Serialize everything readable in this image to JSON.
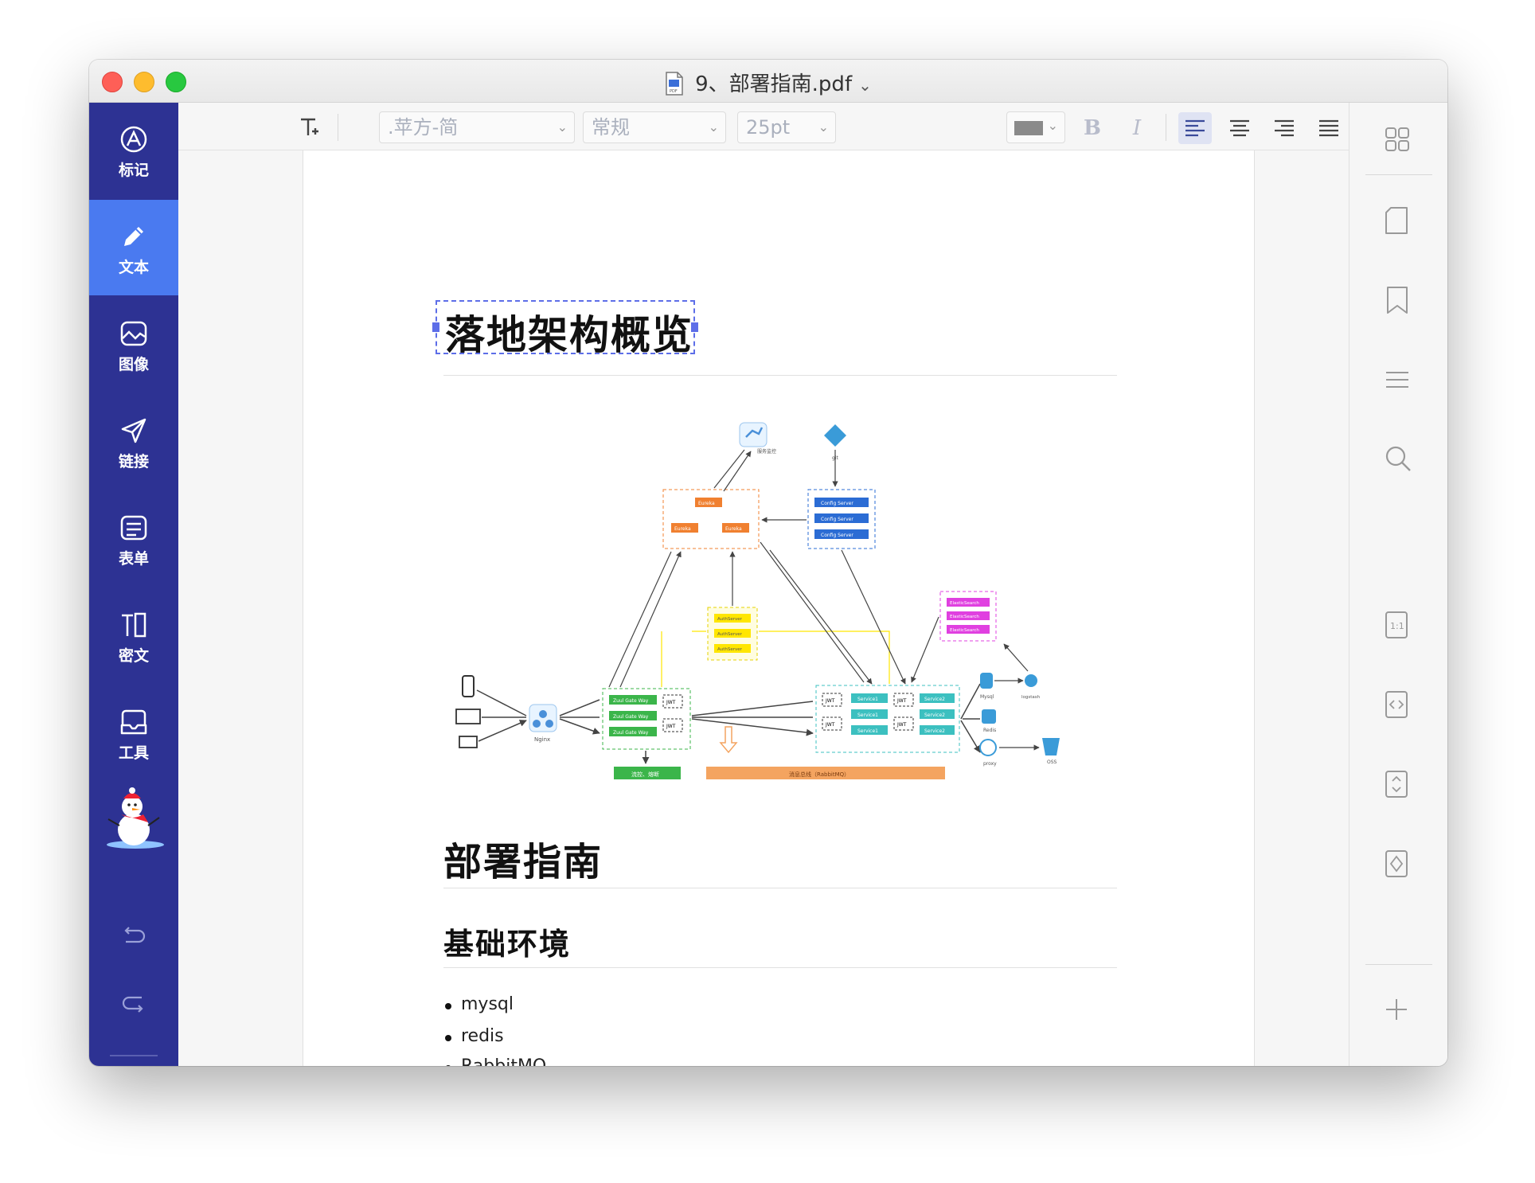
{
  "window": {
    "title": "9、部署指南.pdf"
  },
  "sidebar": {
    "items": [
      {
        "label": "标记",
        "icon": "markup-icon"
      },
      {
        "label": "文本",
        "icon": "pencil-icon",
        "active": true
      },
      {
        "label": "图像",
        "icon": "image-icon"
      },
      {
        "label": "链接",
        "icon": "link-icon"
      },
      {
        "label": "表单",
        "icon": "form-icon"
      },
      {
        "label": "密文",
        "icon": "redact-icon"
      },
      {
        "label": "工具",
        "icon": "tools-icon"
      }
    ],
    "active_color": "#4a7af0",
    "bg_color": "#2d3293"
  },
  "toolbar": {
    "font_family": ".苹方-简",
    "font_weight": "常规",
    "font_size": "25pt",
    "text_color": "#8a8a8a",
    "bold_label": "B",
    "italic_label": "I",
    "alignment": "left"
  },
  "document": {
    "heading": "落地架构概览",
    "section_title": "部署指南",
    "subsection_title": "基础环境",
    "list_items": [
      "mysql",
      "redis",
      "RabbitMQ"
    ]
  },
  "diagram": {
    "labels": {
      "nginx": "Nginx",
      "eureka": "Eureka",
      "config_server": "Config Server",
      "elasticsearch": "ElasticSearch",
      "auth_server": "AuthServer",
      "zuul": "Zuul Gate Way",
      "jwt": "JWT",
      "service1": "Service1",
      "service2": "Service2",
      "mysql": "Mysql",
      "logstash": "logstash",
      "redis": "Redis",
      "proxy": "proxy",
      "oss": "OSS",
      "mq_bar": "消息总线（RabbitMQ）",
      "limit_bar": "流控、熔断",
      "monitor": "服务监控",
      "git": "git"
    }
  },
  "rightbar": {
    "icons": [
      "thumbnails-icon",
      "page-icon",
      "bookmark-icon",
      "outline-icon",
      "search-icon",
      "actual-size-icon",
      "fit-width-icon",
      "fit-height-icon",
      "fit-page-icon",
      "zoom-in-icon",
      "zoom-out-icon"
    ]
  }
}
